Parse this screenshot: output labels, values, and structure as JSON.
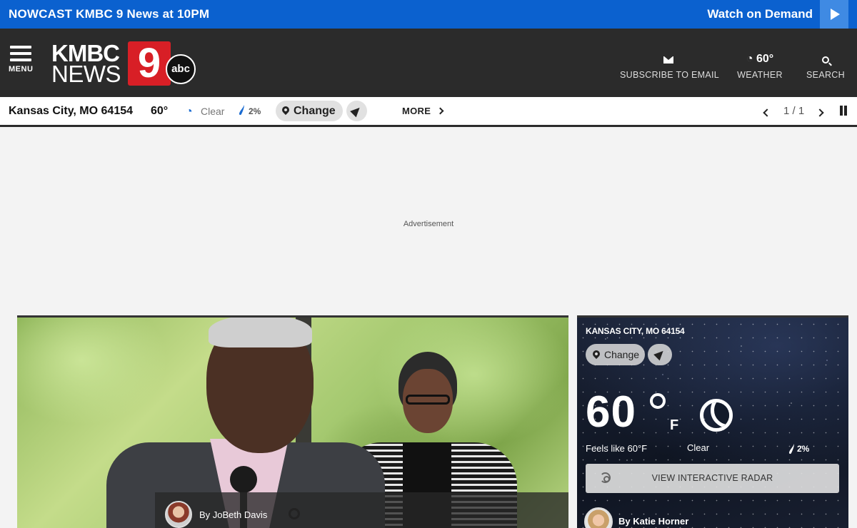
{
  "promo": {
    "text": "NOWCAST KMBC 9 News at 10PM",
    "watch_label": "Watch on Demand"
  },
  "header": {
    "menu_label": "MENU",
    "logo": {
      "line1": "KMBC",
      "line2": "NEWS",
      "nine": "9",
      "abc": "abc"
    },
    "actions": {
      "email_label": "SUBSCRIBE TO EMAIL",
      "weather_temp": "60°",
      "weather_label": "WEATHER",
      "search_label": "SEARCH"
    }
  },
  "weather_bar": {
    "location": "Kansas City, MO 64154",
    "temp": "60°",
    "condition": "Clear",
    "precip": "2%",
    "change_label": "Change",
    "more_label": "MORE",
    "pager": "1 / 1"
  },
  "ad": {
    "label": "Advertisement"
  },
  "video": {
    "byline": "By JoBeth Davis"
  },
  "weather_widget": {
    "location": "KANSAS CITY, MO 64154",
    "change_label": "Change",
    "temp": "60",
    "unit": "F",
    "feels_like": "Feels like 60°F",
    "condition": "Clear",
    "precip": "2%",
    "radar_label": "VIEW INTERACTIVE RADAR",
    "author": "By Katie Horner"
  },
  "colors": {
    "promo_blue": "#0b61cf",
    "header_dark": "#2b2b2b",
    "logo_red": "#d81f26",
    "moon_blue": "#1a6bd1"
  },
  "icons": [
    "play-icon",
    "hamburger-icon",
    "envelope-icon",
    "moon-icon",
    "search-icon",
    "raindrop-icon",
    "location-pin-icon",
    "locate-arrow-icon",
    "chevron-right-icon",
    "chevron-left-icon",
    "pause-icon",
    "radar-icon"
  ]
}
